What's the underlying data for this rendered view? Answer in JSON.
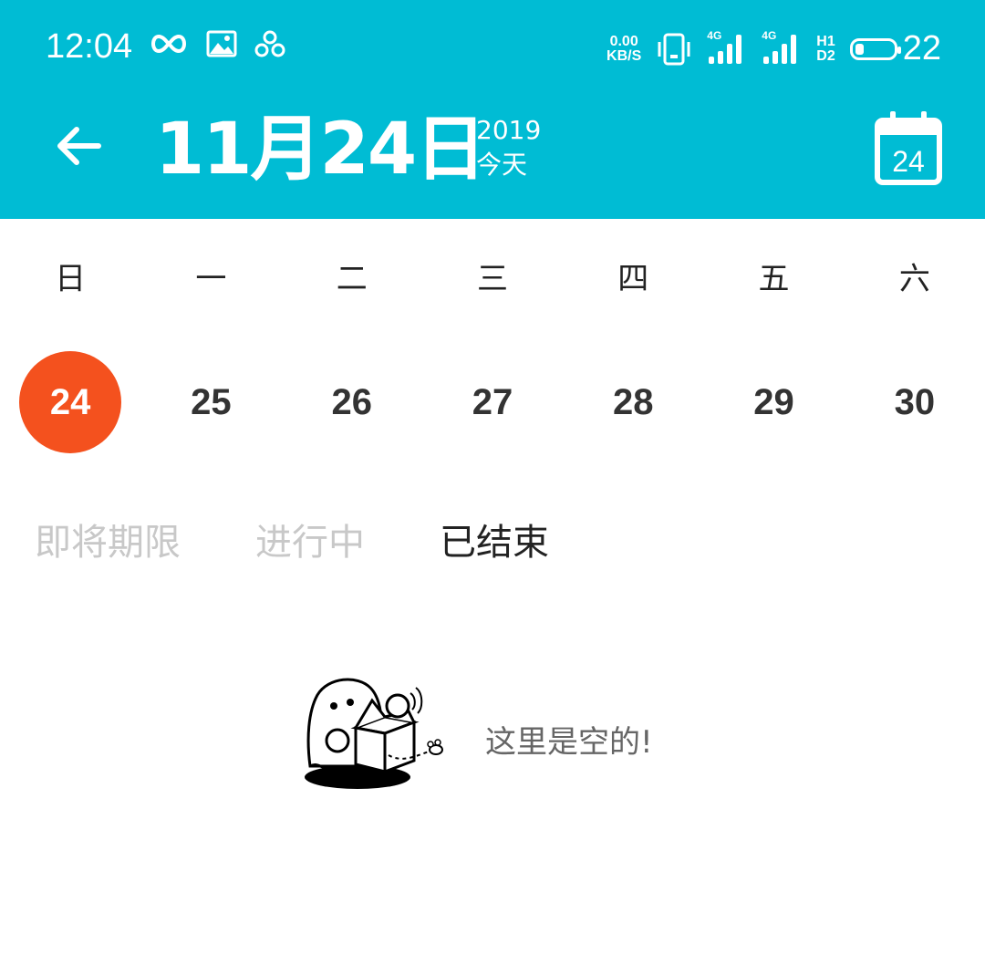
{
  "status": {
    "time": "12:04",
    "net_speed_value": "0.00",
    "net_speed_unit": "KB/S",
    "sim1_type": "4G",
    "sim2_type": "4G",
    "hd_top": "H1",
    "hd_bottom": "D2",
    "battery_level": 22,
    "battery_text": "22"
  },
  "header": {
    "date": "11月24日",
    "year": "2019",
    "relative_day": "今天",
    "calendar_icon_day": "24",
    "background": "#00bcd4"
  },
  "week": {
    "days": [
      "日",
      "一",
      "二",
      "三",
      "四",
      "五",
      "六"
    ],
    "dates": [
      "24",
      "25",
      "26",
      "27",
      "28",
      "29",
      "30"
    ],
    "selected_index": 0,
    "selected_color": "#f4511e"
  },
  "tabs": [
    {
      "label": "即将期限",
      "active": false
    },
    {
      "label": "进行中",
      "active": false
    },
    {
      "label": "已结束",
      "active": true
    }
  ],
  "empty_state": {
    "message": "这里是空的!",
    "illustration": "ghost-with-box-illustration"
  }
}
